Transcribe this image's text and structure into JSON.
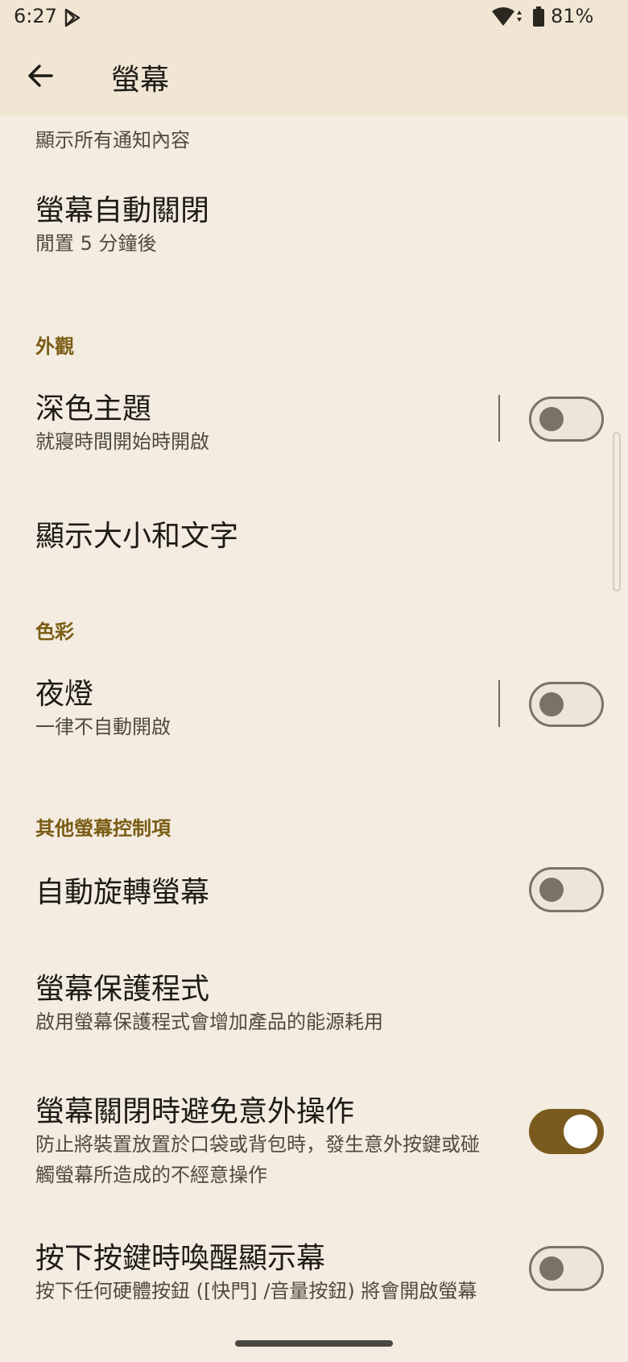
{
  "status_bar": {
    "time": "6:27",
    "battery": "81%"
  },
  "app_bar": {
    "title": "螢幕"
  },
  "items": {
    "lock_screen_summary": "顯示所有通知內容",
    "screen_timeout": {
      "title": "螢幕自動關閉",
      "summary": "閒置 5 分鐘後"
    },
    "appearance_header": "外觀",
    "dark_theme": {
      "title": "深色主題",
      "summary": "就寢時間開始時開啟",
      "checked": false
    },
    "display_size": {
      "title": "顯示大小和文字"
    },
    "color_header": "色彩",
    "night_light": {
      "title": "夜燈",
      "summary": "一律不自動開啟",
      "checked": false
    },
    "other_header": "其他螢幕控制項",
    "auto_rotate": {
      "title": "自動旋轉螢幕",
      "checked": false
    },
    "screen_saver": {
      "title": "螢幕保護程式",
      "summary": "啟用螢幕保護程式會增加產品的能源耗用"
    },
    "pocket_mode": {
      "title": "螢幕關閉時避免意外操作",
      "summary_line1": "防止將裝置放置於口袋或背包時，發生意外按鍵或碰",
      "summary_line2": "觸螢幕所造成的不經意操作",
      "checked": true
    },
    "wake_on_key": {
      "title": "按下按鍵時喚醒顯示幕",
      "summary": "按下任何硬體按鈕 ([快門] /音量按鈕) 將會開啟螢幕",
      "checked": false
    }
  },
  "colors": {
    "background": "#f4ece1",
    "header": "#f1e6d4",
    "accent": "#7a5a1d",
    "section_header": "#7a5c14"
  }
}
